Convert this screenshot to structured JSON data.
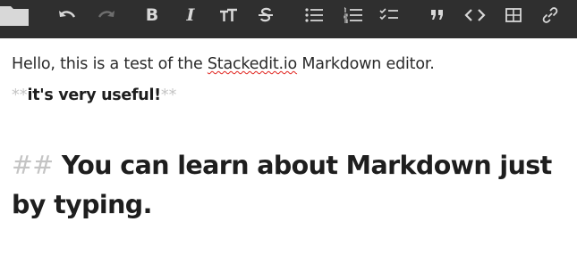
{
  "toolbar": {
    "buttons": [
      {
        "name": "folder-button",
        "icon": "folder-icon"
      },
      {
        "name": "undo-button",
        "icon": "undo-icon"
      },
      {
        "name": "redo-button",
        "icon": "redo-icon"
      },
      {
        "name": "bold-button",
        "icon": "bold-icon",
        "glyph": "B"
      },
      {
        "name": "italic-button",
        "icon": "italic-icon",
        "glyph": "I"
      },
      {
        "name": "heading-button",
        "icon": "text-size-icon",
        "glyph": "TT"
      },
      {
        "name": "strikethrough-button",
        "icon": "strikethrough-icon",
        "glyph": "S"
      },
      {
        "name": "unordered-list-button",
        "icon": "bulleted-list-icon"
      },
      {
        "name": "ordered-list-button",
        "icon": "numbered-list-icon"
      },
      {
        "name": "checklist-button",
        "icon": "checklist-icon"
      },
      {
        "name": "quote-button",
        "icon": "quote-icon",
        "glyph": "”"
      },
      {
        "name": "code-button",
        "icon": "code-icon",
        "glyph": "<>"
      },
      {
        "name": "table-button",
        "icon": "table-icon"
      },
      {
        "name": "link-button",
        "icon": "link-icon"
      }
    ],
    "colors": {
      "background": "#2f2f2f",
      "icon": "#d8d8d8",
      "disabled": "#6e6e6e"
    }
  },
  "editor": {
    "line1": {
      "before": "Hello, this is a test of the ",
      "misspelled": "Stackedit.io",
      "after": " Markdown editor."
    },
    "line2": {
      "open_mark": "**",
      "bold": "it's very useful!",
      "close_mark": "**"
    },
    "heading": {
      "mark": "##",
      "text": "You can learn about Markdown just by typing."
    },
    "colors": {
      "text": "#222222",
      "markdown_syntax": "#c4c4c4",
      "spellcheck": "#e0201a"
    }
  }
}
